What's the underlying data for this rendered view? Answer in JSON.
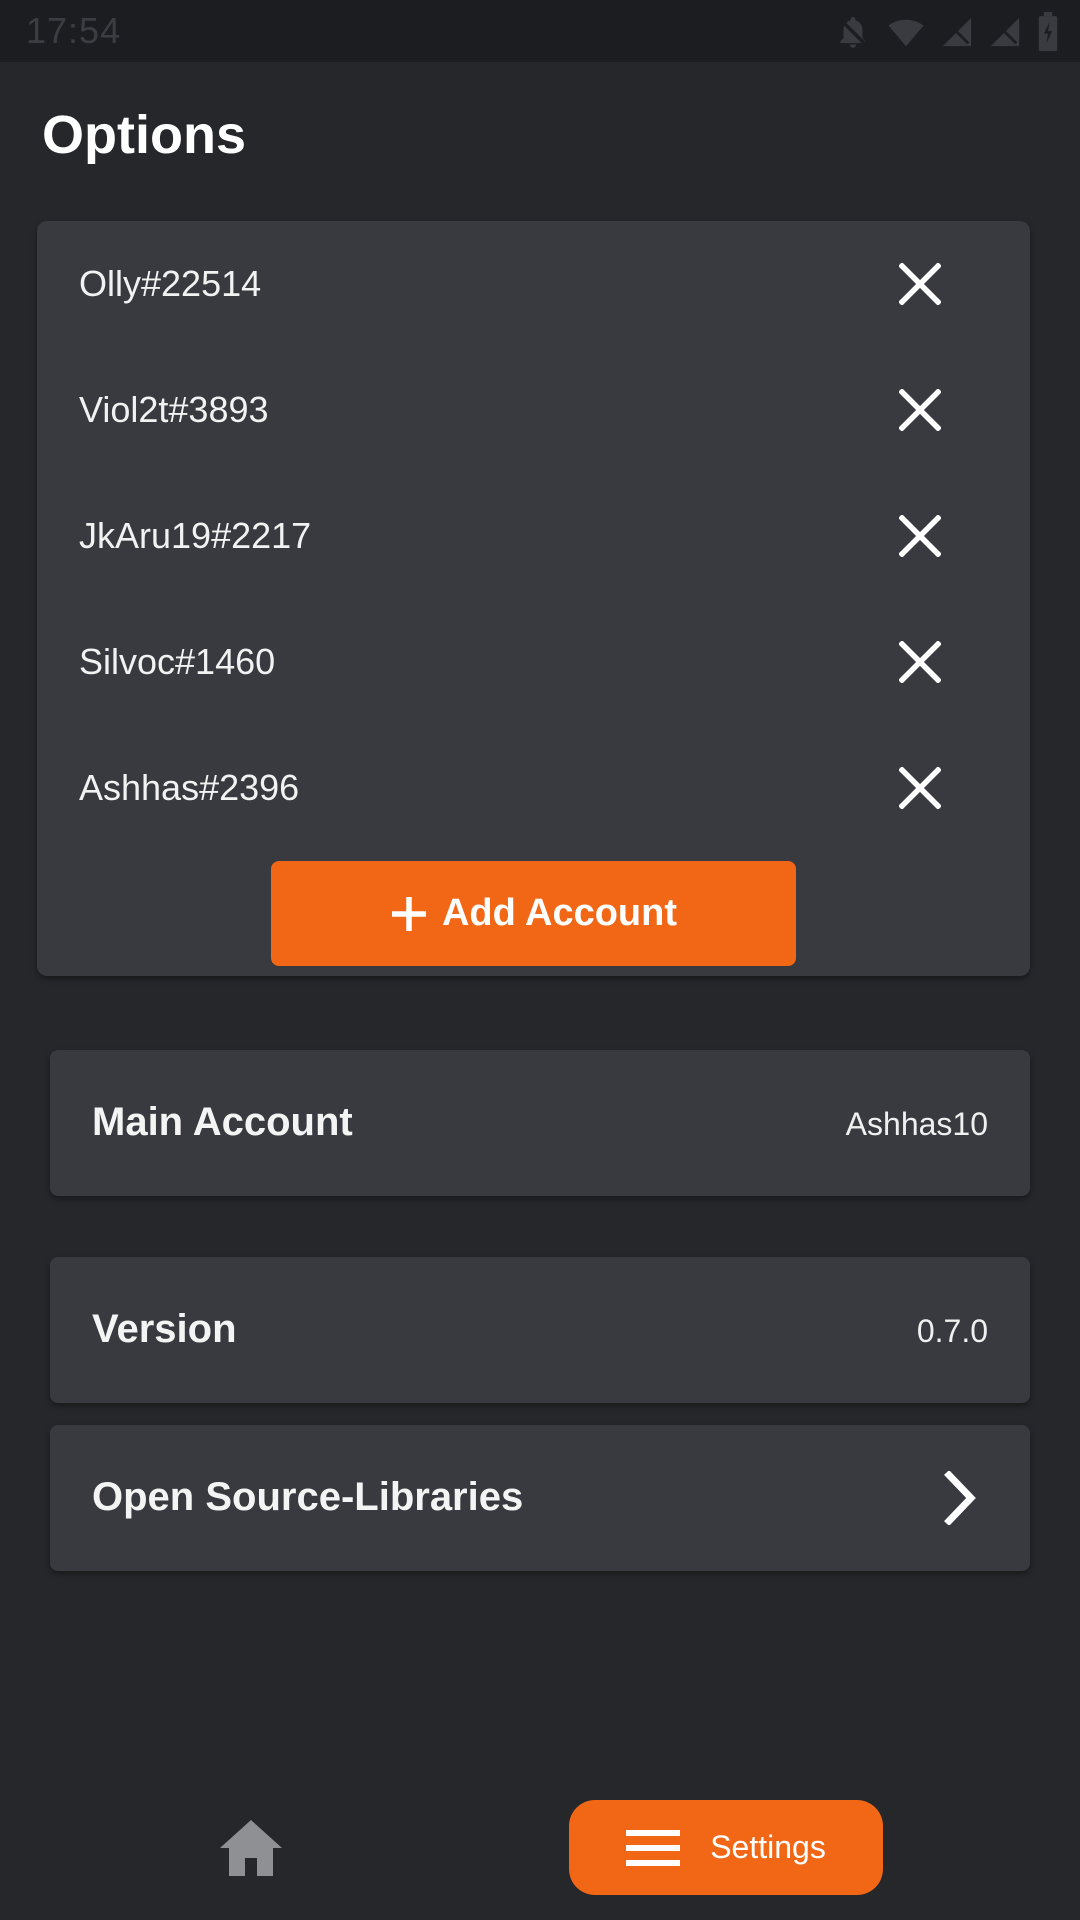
{
  "status_bar": {
    "time": "17:54"
  },
  "page": {
    "title": "Options"
  },
  "accounts": {
    "items": [
      {
        "name": "Olly#22514"
      },
      {
        "name": "Viol2t#3893"
      },
      {
        "name": "JkAru19#2217"
      },
      {
        "name": "Silvoc#1460"
      },
      {
        "name": "Ashhas#2396"
      }
    ],
    "add_button_label": "Add Account"
  },
  "settings": {
    "main_account": {
      "label": "Main Account",
      "value": "Ashhas10"
    },
    "version": {
      "label": "Version",
      "value": "0.7.0"
    },
    "open_source": {
      "label": "Open Source-Libraries"
    }
  },
  "bottom_nav": {
    "settings_label": "Settings"
  },
  "colors": {
    "accent": "#f26716",
    "background": "#26272b",
    "card": "#383a3f"
  }
}
